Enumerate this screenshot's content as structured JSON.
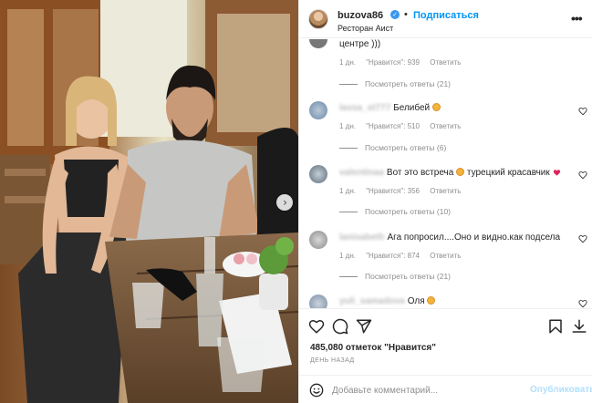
{
  "header": {
    "username": "buzova86",
    "follow_label": "Подписаться",
    "location": "Ресторан Аист",
    "separator": "•"
  },
  "comments": [
    {
      "text": "центре )))",
      "time": "1 дн.",
      "likes": "\"Нравится\": 939",
      "reply": "Ответить",
      "view_replies": "Посмотреть ответы (21)"
    },
    {
      "author": "lassa_st777",
      "text": "Белибей",
      "emoji": "face",
      "time": "1 дн.",
      "likes": "\"Нравится\": 510",
      "reply": "Ответить",
      "view_replies": "Посмотреть ответы (6)"
    },
    {
      "author": "valentinaa",
      "text": "Вот это встреча",
      "text2": "турецкий красавчик",
      "time": "1 дн.",
      "likes": "\"Нравится\": 356",
      "reply": "Ответить",
      "view_replies": "Посмотреть ответы (10)"
    },
    {
      "author": "lanisabeth",
      "text": "Ага попросил....Оно и видно.как подсела",
      "time": "1 дн.",
      "likes": "\"Нравится\": 874",
      "reply": "Ответить",
      "view_replies": "Посмотреть ответы (21)"
    },
    {
      "author": "yuli_samadova",
      "text": "Оля",
      "time": "",
      "likes": "",
      "reply": "",
      "view_replies": ""
    }
  ],
  "post": {
    "likes_label": "485,080 отметок \"Нравится\"",
    "time_ago": "ДЕНЬ НАЗАД"
  },
  "comment_box": {
    "placeholder": "Добавьте комментарий...",
    "publish_label": "Опубликовать"
  },
  "icons": {
    "carousel_next": "chevron-right-icon",
    "like": "heart-icon",
    "comment": "comment-icon",
    "share": "paper-plane-icon",
    "save": "bookmark-icon",
    "download": "download-icon",
    "emoji": "smile-icon",
    "more": "more-icon"
  },
  "colors": {
    "accent": "#0095f6",
    "verified": "#3897f0",
    "publish_disabled": "#b2dffc",
    "meta_text": "#8e8e8e",
    "heart_emoji": "#e0245e"
  }
}
